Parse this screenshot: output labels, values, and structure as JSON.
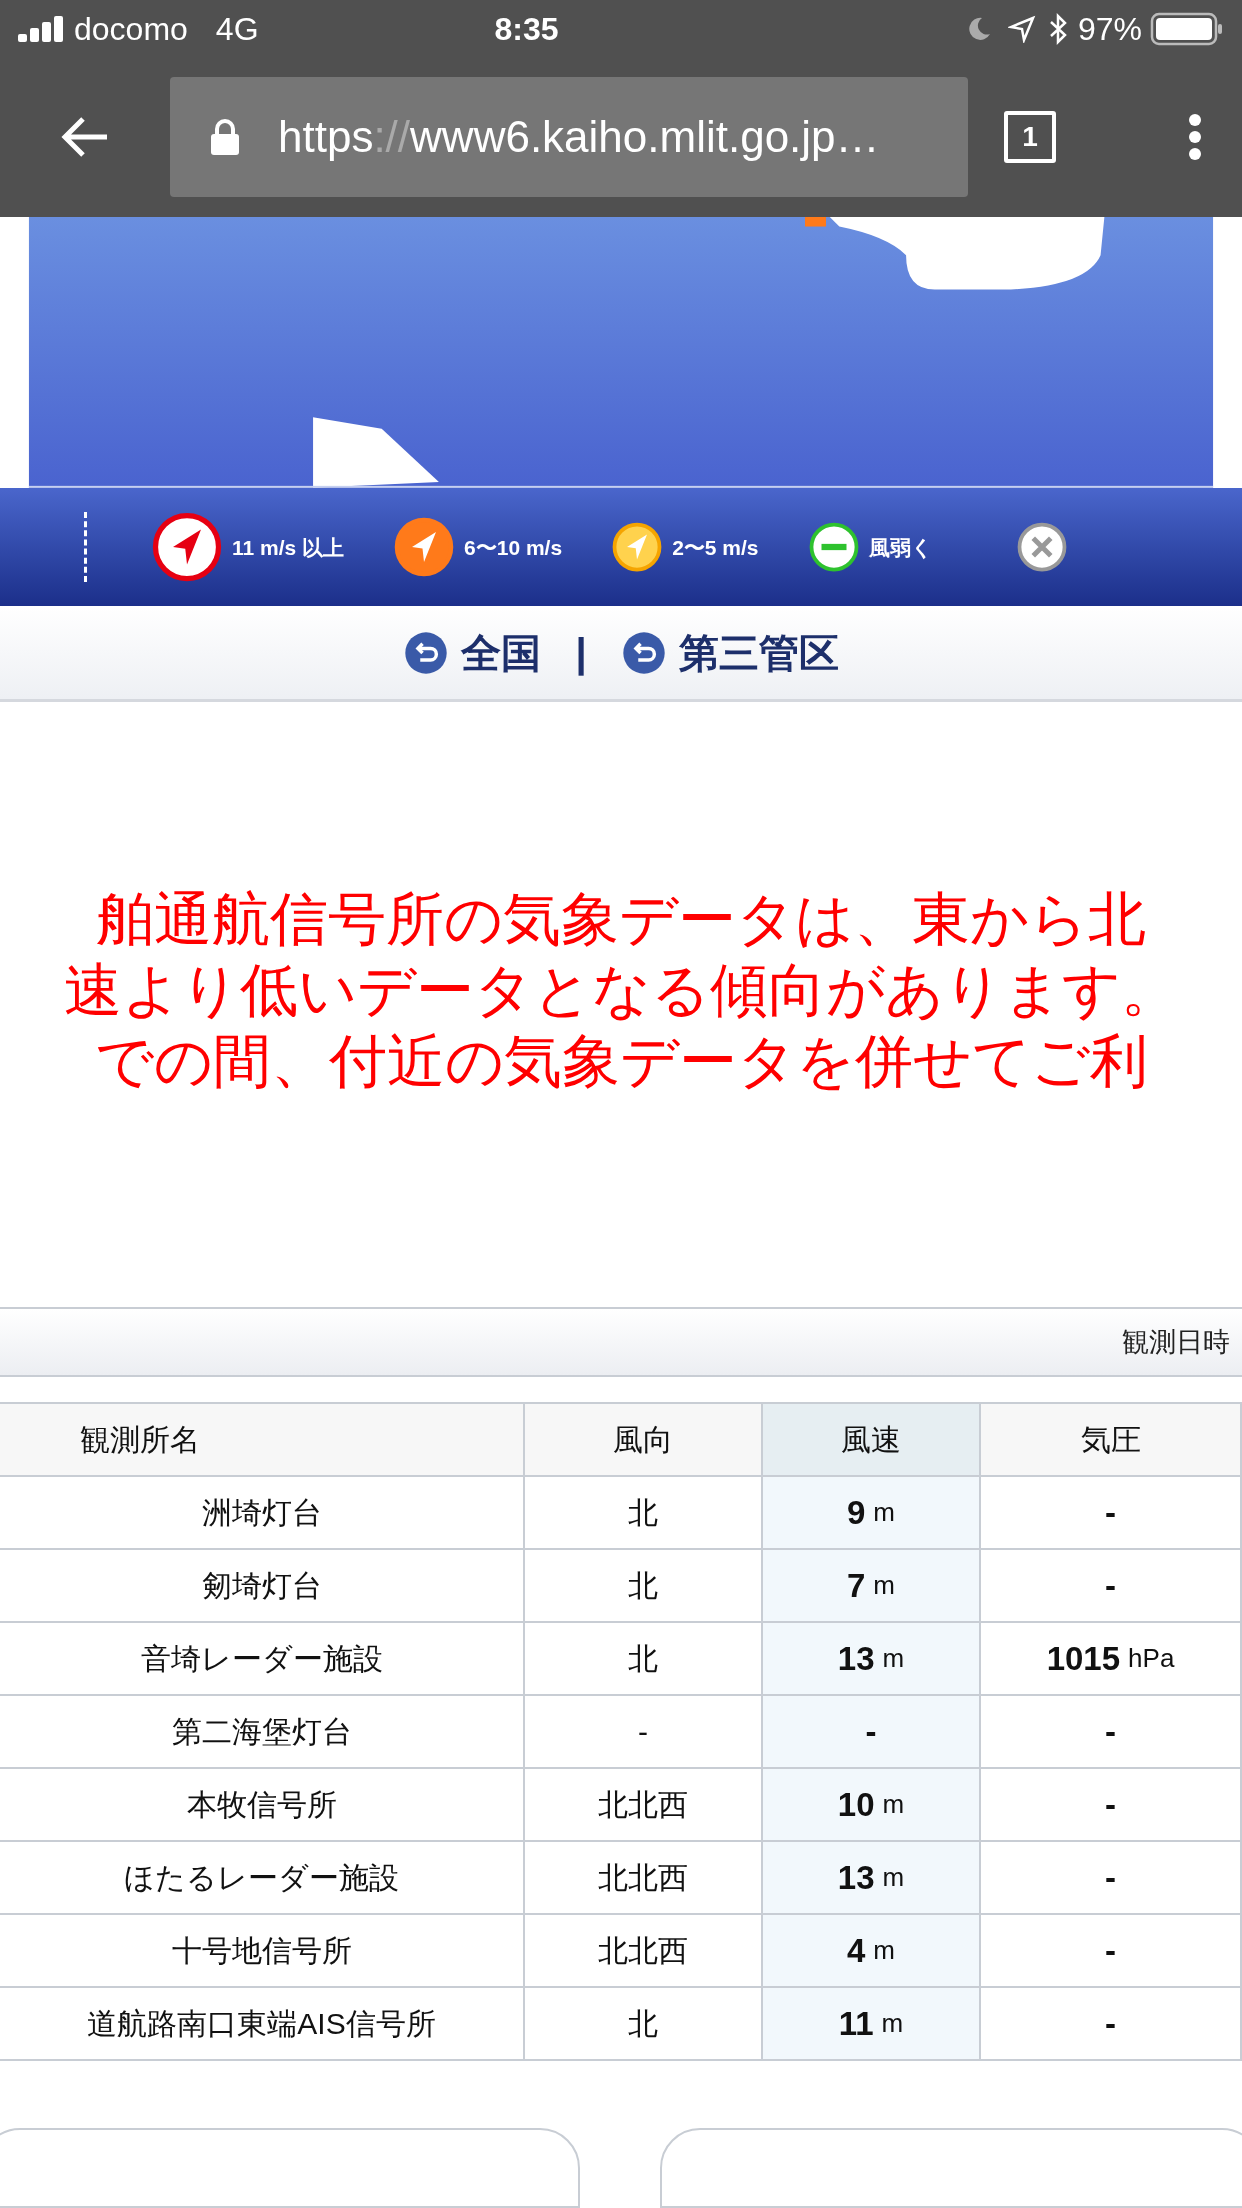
{
  "status_bar": {
    "carrier": "docomo",
    "network": "4G",
    "time": "8:35",
    "battery": "97%"
  },
  "browser": {
    "url_scheme": "https",
    "url_separator": "://",
    "url_host": "www6.kaiho.mlit.go.jp…",
    "tab_count": "1"
  },
  "legend": [
    {
      "kind": "strong",
      "label": "11 m/s 以上"
    },
    {
      "kind": "moderate",
      "label": "6〜10 m/s"
    },
    {
      "kind": "light",
      "label": "2〜5 m/s"
    },
    {
      "kind": "calm",
      "label": "風弱く"
    },
    {
      "kind": "missing"
    }
  ],
  "nav": {
    "links": [
      "全国",
      "第三管区"
    ],
    "separator": "|"
  },
  "notice": [
    "舶通航信号所の気象データは、東から北",
    "速より低いデータとなる傾向があります。",
    "での間、付近の気象データを併せてご利"
  ],
  "observation": {
    "datetime_label": "観測日時"
  },
  "table": {
    "columns": [
      {
        "label": "観測所名",
        "highlighted": false
      },
      {
        "label": "風向",
        "highlighted": false
      },
      {
        "label": "風速",
        "highlighted": true
      },
      {
        "label": "気圧",
        "highlighted": false
      }
    ],
    "rows": [
      {
        "name": "洲埼灯台",
        "direction": "北",
        "speed": "9",
        "speed_unit": "m",
        "pressure": "-"
      },
      {
        "name": "剱埼灯台",
        "direction": "北",
        "speed": "7",
        "speed_unit": "m",
        "pressure": "-"
      },
      {
        "name": "音埼レーダー施設",
        "direction": "北",
        "speed": "13",
        "speed_unit": "m",
        "pressure": "1015",
        "pressure_unit": "hPa"
      },
      {
        "name": "第二海堡灯台",
        "direction": "-",
        "speed": "-",
        "pressure": "-"
      },
      {
        "name": "本牧信号所",
        "direction": "北北西",
        "speed": "10",
        "speed_unit": "m",
        "pressure": "-"
      },
      {
        "name": "ほたるレーダー施設",
        "direction": "北北西",
        "speed": "13",
        "speed_unit": "m",
        "pressure": "-"
      },
      {
        "name": "十号地信号所",
        "direction": "北北西",
        "speed": "4",
        "speed_unit": "m",
        "pressure": "-"
      },
      {
        "name": "道航路南口東端AIS信号所",
        "direction": "北",
        "speed": "11",
        "speed_unit": "m",
        "pressure": "-"
      }
    ]
  }
}
